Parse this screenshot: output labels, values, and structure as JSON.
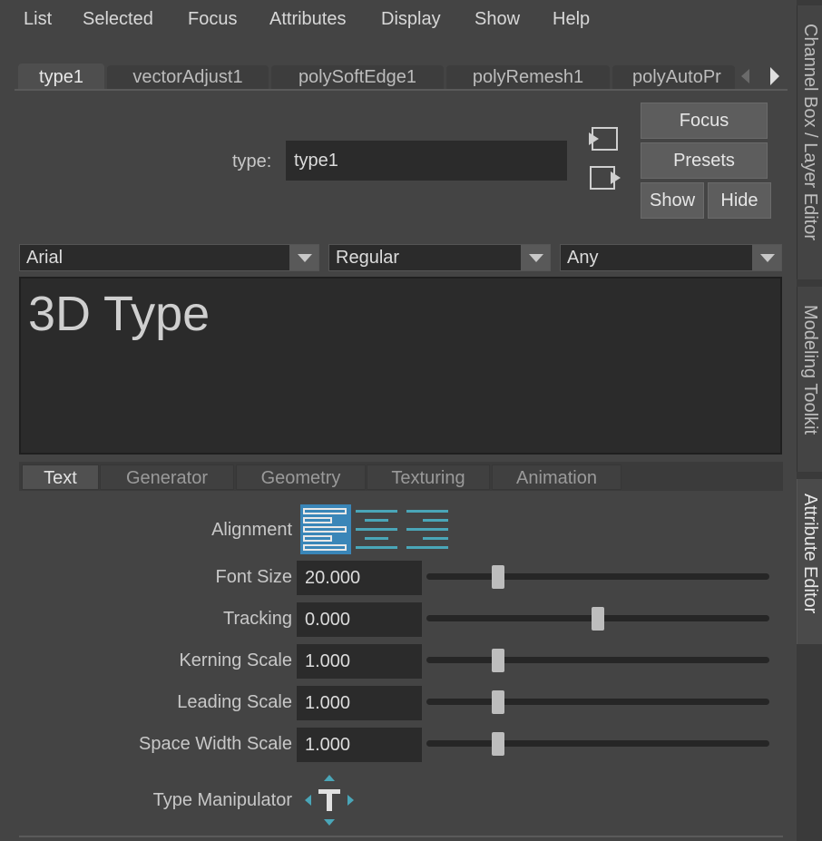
{
  "menu": [
    "List",
    "Selected",
    "Focus",
    "Attributes",
    "Display",
    "Show",
    "Help"
  ],
  "dock_tabs": [
    "Channel Box / Layer Editor",
    "Modeling Toolkit",
    "Attribute Editor"
  ],
  "node_tabs": [
    "type1",
    "vectorAdjust1",
    "polySoftEdge1",
    "polyRemesh1",
    "polyAutoPr"
  ],
  "type_field": {
    "label": "type:",
    "value": "type1"
  },
  "buttons": {
    "focus": "Focus",
    "presets": "Presets",
    "show": "Show",
    "hide": "Hide"
  },
  "font_dropdowns": [
    "Arial",
    "Regular",
    "Any"
  ],
  "text_content": "3D Type",
  "sub_tabs": [
    "Text",
    "Generator",
    "Geometry",
    "Texturing",
    "Animation"
  ],
  "alignment_label": "Alignment",
  "alignment_selected": "left",
  "attributes": [
    {
      "label": "Font Size",
      "value": "20.000",
      "slider_fraction": 0.21
    },
    {
      "label": "Tracking",
      "value": "0.000",
      "slider_fraction": 0.5
    },
    {
      "label": "Kerning Scale",
      "value": "1.000",
      "slider_fraction": 0.21
    },
    {
      "label": "Leading Scale",
      "value": "1.000",
      "slider_fraction": 0.21
    },
    {
      "label": "Space Width Scale",
      "value": "1.000",
      "slider_fraction": 0.21
    }
  ],
  "type_manipulator_label": "Type Manipulator",
  "colors": {
    "accent": "#3a9fd8",
    "icon_teal": "#4aa6b8",
    "background": "#444444",
    "field": "#2b2b2b"
  }
}
